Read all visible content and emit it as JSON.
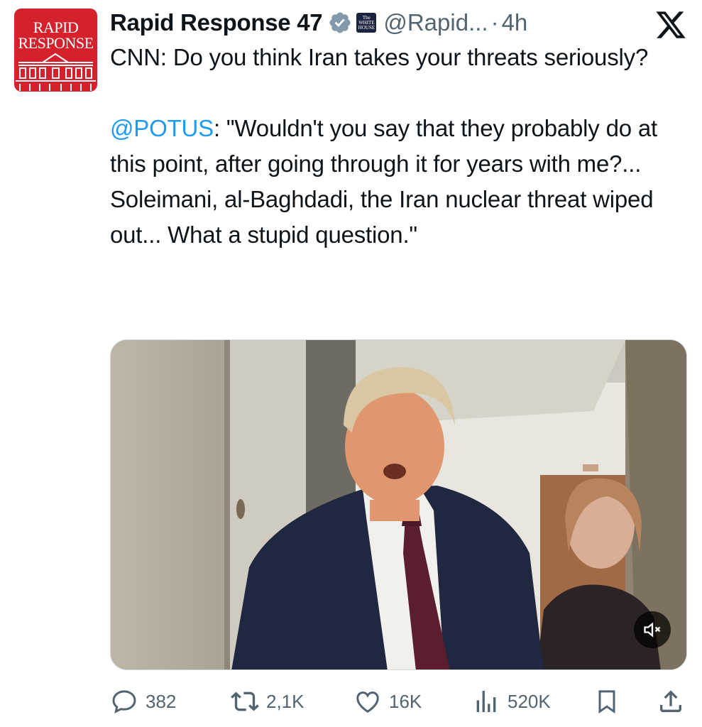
{
  "author": {
    "display_name": "Rapid Response 47",
    "handle": "@Rapid...",
    "separator": "·",
    "time": "4h",
    "verified_icon": "verified-badge-icon",
    "affiliate_badge": {
      "line1": "The",
      "line2": "WHITE",
      "line3": "HOUSE"
    },
    "avatar": {
      "line1": "RAPID",
      "line2": "RESPONSE",
      "bg_color": "#d4212b"
    }
  },
  "platform_logo": "x-logo-icon",
  "tweet": {
    "line1": "CNN: Do you think Iran takes your threats seriously?",
    "mention": "@POTUS",
    "quote": ": \"Wouldn't you say that they probably do at this point, after going through it for years with me?... Soleimani, al-Baghdadi, the Iran nuclear threat wiped out... What a stupid question.\""
  },
  "media": {
    "type": "video",
    "muted_icon": "volume-muted-icon"
  },
  "actions": {
    "replies": "382",
    "reposts": "2,1K",
    "likes": "16K",
    "views": "520K"
  },
  "colors": {
    "mention": "#1d9bf0",
    "secondary_text": "#536471",
    "verified": "#829aab"
  }
}
